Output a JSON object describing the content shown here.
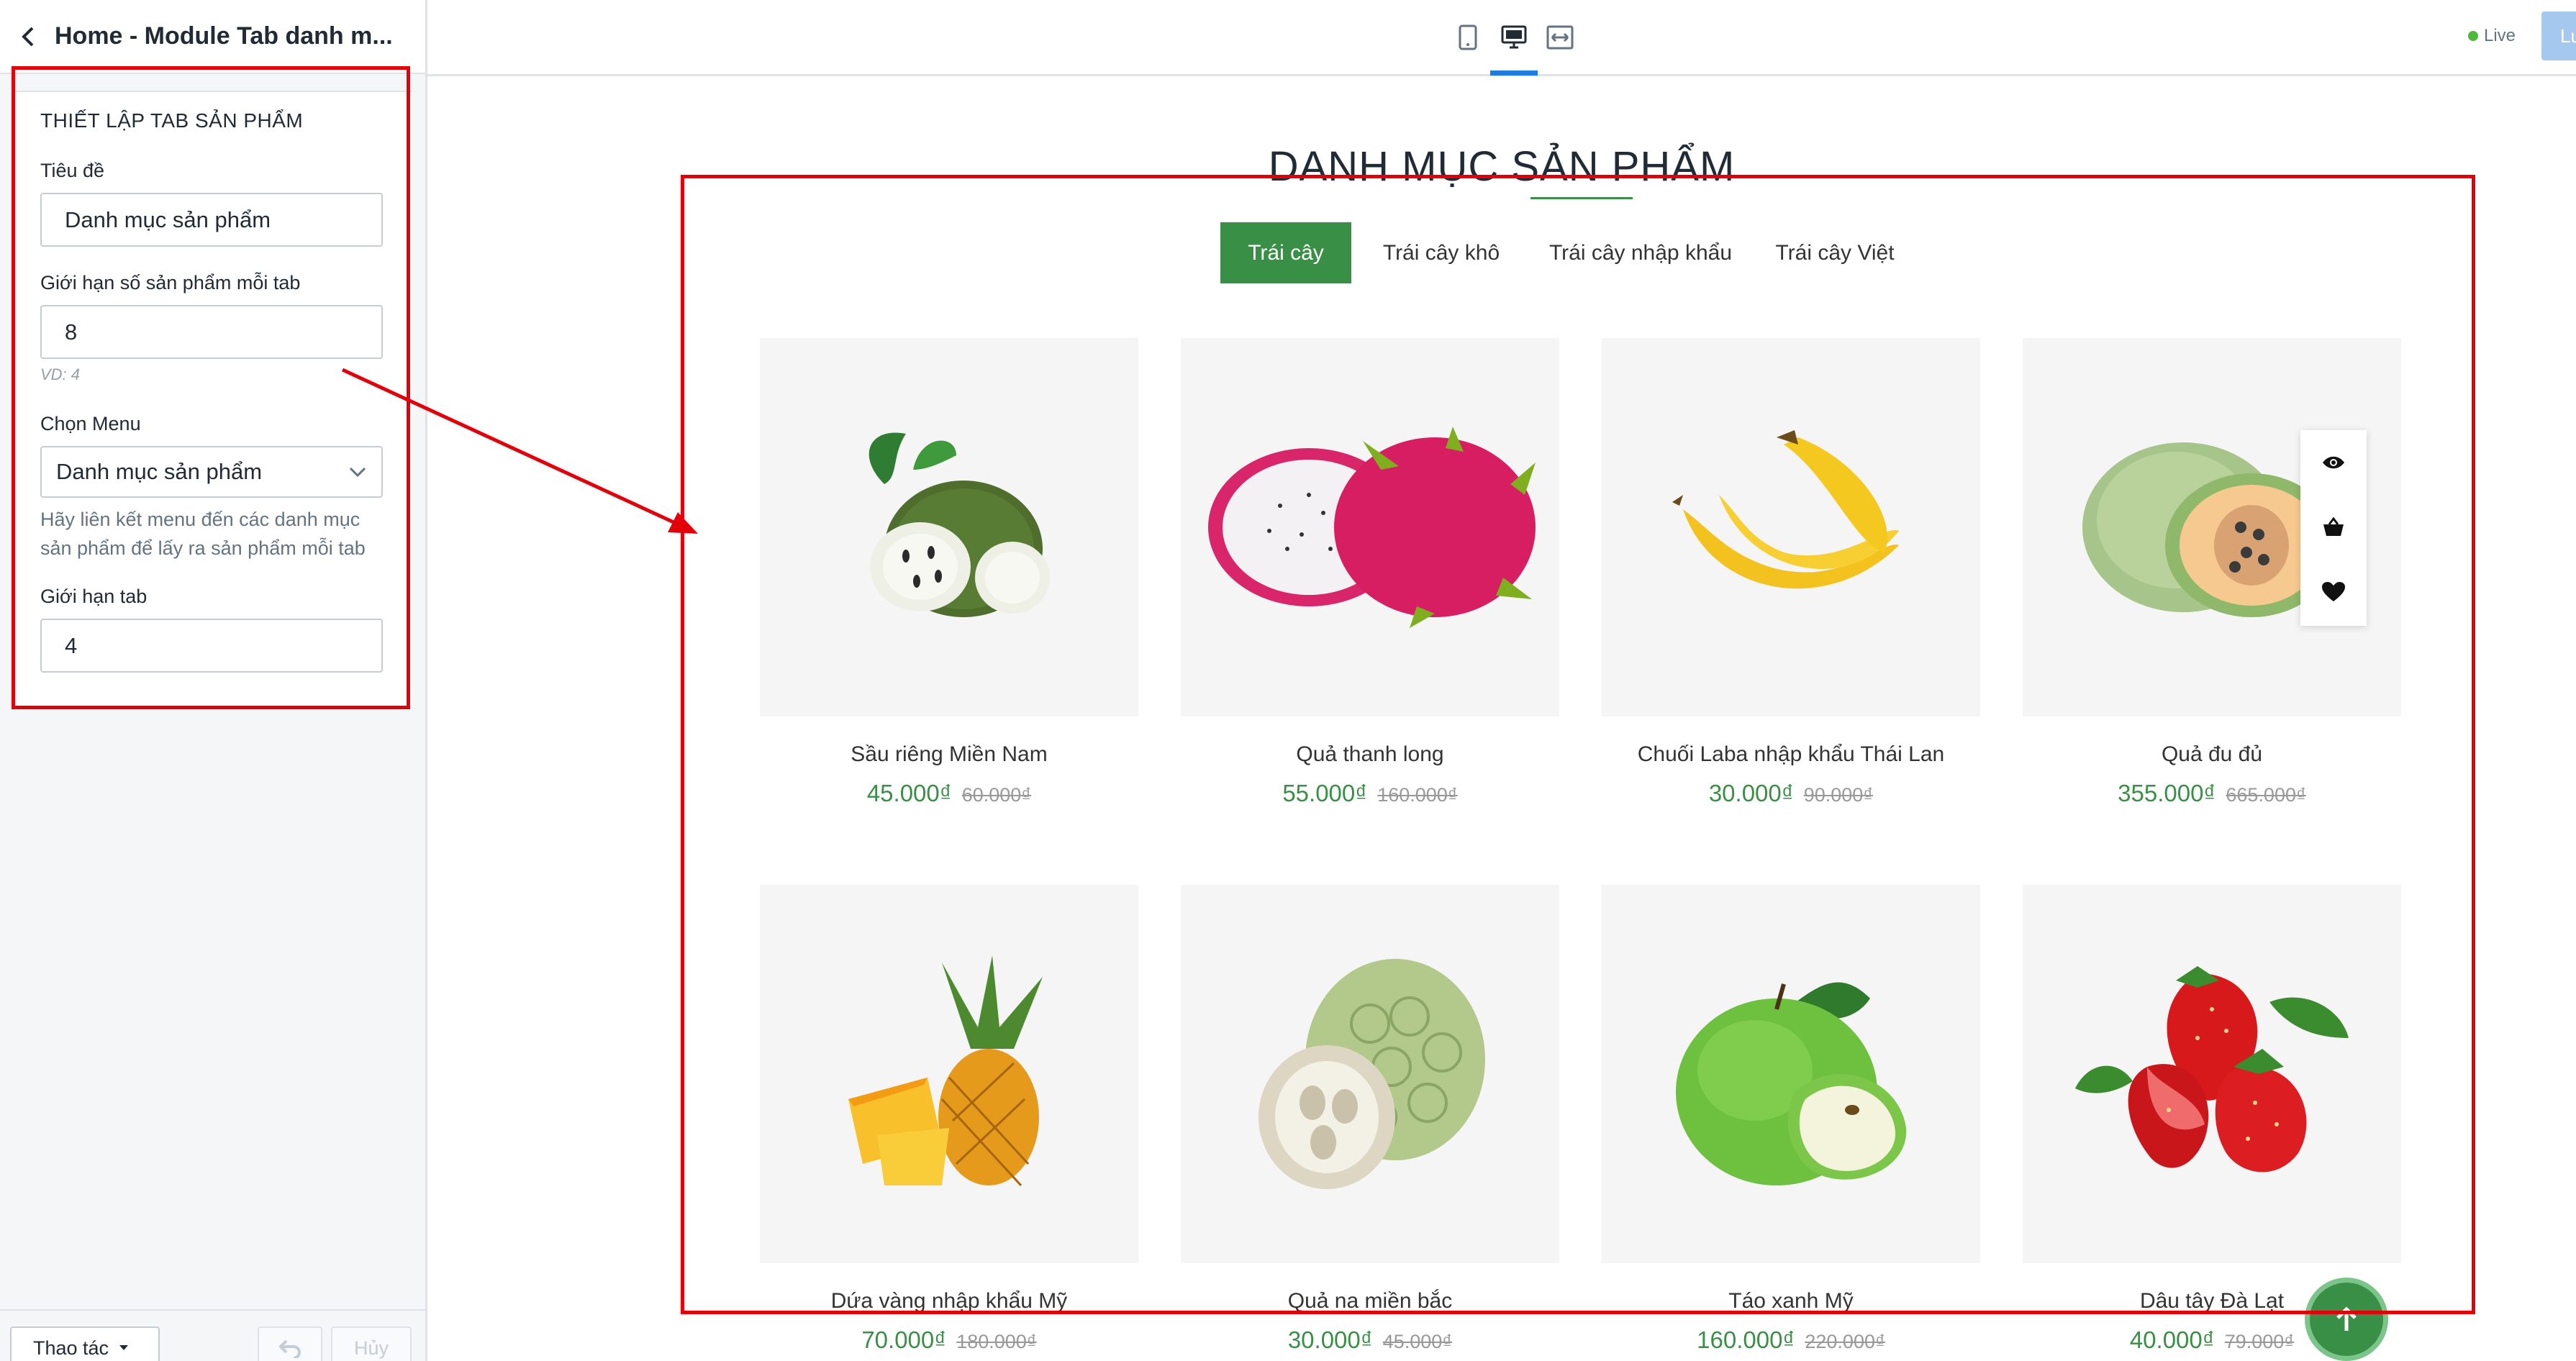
{
  "sidebar": {
    "title": "Home - Module Tab danh m...",
    "section_heading": "THIẾT LẬP TAB SẢN PHẨM",
    "fields": {
      "title_label": "Tiêu đề",
      "title_value": "Danh mục sản phẩm",
      "limit_label": "Giới hạn số sản phẩm mỗi tab",
      "limit_value": "8",
      "limit_hint": "VD: 4",
      "menu_label": "Chọn Menu",
      "menu_value": "Danh mục sản phẩm",
      "menu_help": "Hãy liên kết menu đến các danh mục sản phẩm để lấy ra sản phẩm mỗi tab",
      "tab_limit_label": "Giới hạn tab",
      "tab_limit_value": "4"
    },
    "footer": {
      "actions_label": "Thao tác",
      "cancel_label": "Hủy"
    }
  },
  "topbar": {
    "live_label": "Live",
    "save_label": "Lưu"
  },
  "preview": {
    "title": "DANH MỤC SẢN PHẨM",
    "tabs": [
      "Trái cây",
      "Trái cây khô",
      "Trái cây nhập khẩu",
      "Trái cây Việt"
    ],
    "products": [
      {
        "name": "Sầu riêng Miền Nam",
        "price": "45.000₫",
        "old_price": "60.000₫"
      },
      {
        "name": "Quả thanh long",
        "price": "55.000₫",
        "old_price": "160.000₫"
      },
      {
        "name": "Chuối Laba nhập khẩu Thái Lan",
        "price": "30.000₫",
        "old_price": "90.000₫"
      },
      {
        "name": "Quả đu đủ",
        "price": "355.000₫",
        "old_price": "665.000₫"
      },
      {
        "name": "Dứa vàng nhập khẩu Mỹ",
        "price": "70.000₫",
        "old_price": "180.000₫"
      },
      {
        "name": "Quả na miền bắc",
        "price": "30.000₫",
        "old_price": "45.000₫"
      },
      {
        "name": "Táo xanh Mỹ",
        "price": "160.000₫",
        "old_price": "220.000₫"
      },
      {
        "name": "Dâu tây Đà Lạt",
        "price": "40.000₫",
        "old_price": "79.000₫"
      }
    ]
  },
  "colors": {
    "accent_green": "#3a8f46",
    "annotation_red": "#e3000b",
    "device_active_blue": "#1f7ce0"
  },
  "icons": [
    "chevron-left-icon",
    "mobile-icon",
    "desktop-icon",
    "fullwidth-icon",
    "eye-icon",
    "basket-icon",
    "heart-icon",
    "arrow-up-icon",
    "undo-icon",
    "caret-down-icon"
  ]
}
